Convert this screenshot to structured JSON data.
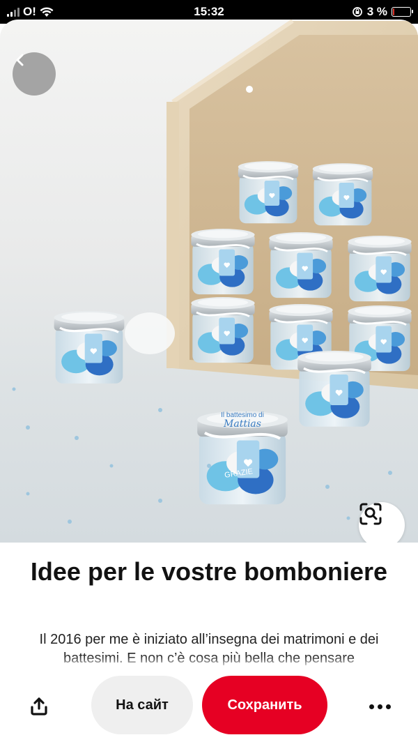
{
  "status_bar": {
    "carrier": "O!",
    "time": "15:32",
    "battery_percent": "3 %",
    "battery_level": 0.03
  },
  "pin": {
    "image_alt": "Glass jars with blue dragées and tags",
    "jar_label_top": "Il battesimo di",
    "jar_label_name": "Mattias",
    "jar_tag_text": "GRAZIE",
    "title": "Idee per le vostre bomboniere",
    "description": "Il 2016 per me è iniziato all’insegna dei matrimoni e dei battesimi. E non c’è cosa più bella che pensare"
  },
  "actions": {
    "share_icon": "share-icon",
    "visit_label": "На сайт",
    "save_label": "Сохранить",
    "more_icon": "more-icon",
    "accent_color": "#e60023"
  }
}
